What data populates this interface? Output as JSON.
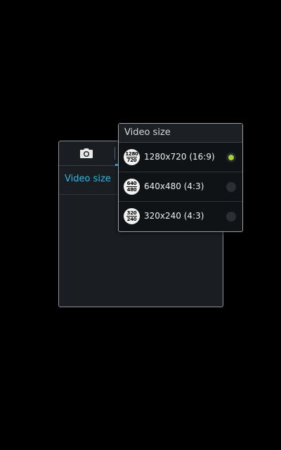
{
  "settings_panel": {
    "row_label": "Video size"
  },
  "popup": {
    "title": "Video size",
    "options": [
      {
        "icon_top": "1280",
        "icon_bottom": "720",
        "label": "1280x720 (16:9)",
        "selected": true
      },
      {
        "icon_top": "640",
        "icon_bottom": "480",
        "label": "640x480 (4:3)",
        "selected": false
      },
      {
        "icon_top": "320",
        "icon_bottom": "240",
        "label": "320x240 (4:3)",
        "selected": false
      }
    ]
  },
  "colors": {
    "background": "#000000",
    "accent_blue": "#33b5e5",
    "radio_selected": "#a4d233"
  },
  "icons": {
    "camera_tab": "camera-icon",
    "option_icon": "resolution-icon",
    "radio": "radio-button"
  }
}
